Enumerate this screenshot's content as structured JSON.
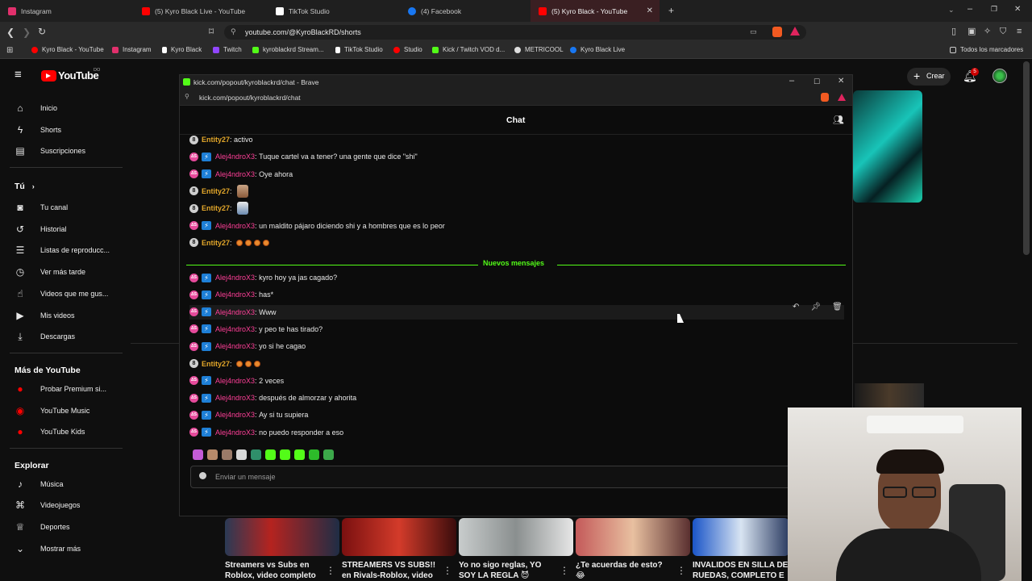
{
  "tabs": [
    {
      "label": "Instagram",
      "color": "#e1306c",
      "active": false
    },
    {
      "label": "(5) Kyro Black Live - YouTube",
      "color": "#ff0000",
      "active": false
    },
    {
      "label": "TikTok Studio",
      "color": "#ffffff",
      "active": false
    },
    {
      "label": "(4) Facebook",
      "color": "#1877f2",
      "active": false
    },
    {
      "label": "(5) Kyro Black - YouTube",
      "color": "#ff0000",
      "active": true
    }
  ],
  "address": {
    "url": "youtube.com/@KyroBlackRD/shorts"
  },
  "bookmarks": [
    "Kyro Black - YouTube",
    "Instagram",
    "Kyro Black",
    "Twitch",
    "kyroblackrd Stream...",
    "TikTok Studio",
    "Studio",
    "Kick / Twitch VOD d...",
    "METRICOOL",
    "Kyro Black Live"
  ],
  "bookmarks_right": "Todos los marcadores",
  "youtube": {
    "logo": "YouTube",
    "logo_sup": "DO",
    "create_label": "Crear",
    "notif_count": "5",
    "nav_main": [
      "Inicio",
      "Shorts",
      "Suscripciones"
    ],
    "you_header": "Tú",
    "nav_you": [
      "Tu canal",
      "Historial",
      "Listas de reproducc...",
      "Ver más tarde",
      "Videos que me gus...",
      "Mis videos",
      "Descargas"
    ],
    "more_header": "Más de YouTube",
    "nav_more": [
      "Probar Premium si...",
      "YouTube Music",
      "YouTube Kids"
    ],
    "explore_header": "Explorar",
    "nav_explore": [
      "Música",
      "Videojuegos",
      "Deportes",
      "Mostrar más"
    ],
    "videos": [
      {
        "title1": "Streamers vs Subs en",
        "title2": "Roblox, video completo"
      },
      {
        "title1": "STREAMERS VS SUBS!!",
        "title2": "en Rivals-Roblox, video"
      },
      {
        "title1": "Yo no sigo reglas, YO",
        "title2": "SOY LA REGLA 😈"
      },
      {
        "title1": "¿Te acuerdas de esto?",
        "title2": "😂"
      },
      {
        "title1": "INVALIDOS EN SILLA DE",
        "title2": "RUEDAS, COMPLETO E"
      }
    ]
  },
  "popup": {
    "window_title": "kick.com/popout/kyroblackrd/chat - Brave",
    "url": "kick.com/popout/kyroblackrd/chat",
    "chat_title": "Chat",
    "new_messages_label": "Nuevos mensajes",
    "input_placeholder": "Enviar un mensaje",
    "messages_before": [
      {
        "user": "Entity27",
        "text": "activo",
        "kind": "e"
      },
      {
        "user": "Alej4ndroX3",
        "text": "Tuque cartel va a tener? una gente que dice \"shi\"",
        "kind": "a"
      },
      {
        "user": "Alej4ndroX3",
        "text": "Oye ahora",
        "kind": "a"
      },
      {
        "user": "Entity27",
        "text": "",
        "kind": "e",
        "sticker": true
      },
      {
        "user": "Entity27",
        "text": "",
        "kind": "e",
        "sticker": true
      },
      {
        "user": "Alej4ndroX3",
        "text": "un maldito pájaro diciendo shi y a hombres que es lo peor",
        "kind": "a"
      },
      {
        "user": "Entity27",
        "text": "",
        "kind": "e",
        "emotes": 4
      }
    ],
    "messages_after": [
      {
        "user": "Alej4ndroX3",
        "text": "kyro hoy ya jas cagado?",
        "kind": "a"
      },
      {
        "user": "Alej4ndroX3",
        "text": "has*",
        "kind": "a"
      },
      {
        "user": "Alej4ndroX3",
        "text": "Www",
        "kind": "a",
        "hover": true
      },
      {
        "user": "Alej4ndroX3",
        "text": "y peo te has tirado?",
        "kind": "a"
      },
      {
        "user": "Alej4ndroX3",
        "text": "yo si he cagao",
        "kind": "a"
      },
      {
        "user": "Entity27",
        "text": "",
        "kind": "e",
        "emotes": 3
      },
      {
        "user": "Alej4ndroX3",
        "text": "2 veces",
        "kind": "a"
      },
      {
        "user": "Alej4ndroX3",
        "text": "después de almorzar y ahorita",
        "kind": "a"
      },
      {
        "user": "Alej4ndroX3",
        "text": "Ay si tu supiera",
        "kind": "a"
      },
      {
        "user": "Alej4ndroX3",
        "text": "no puedo responder a eso",
        "kind": "a"
      }
    ]
  }
}
